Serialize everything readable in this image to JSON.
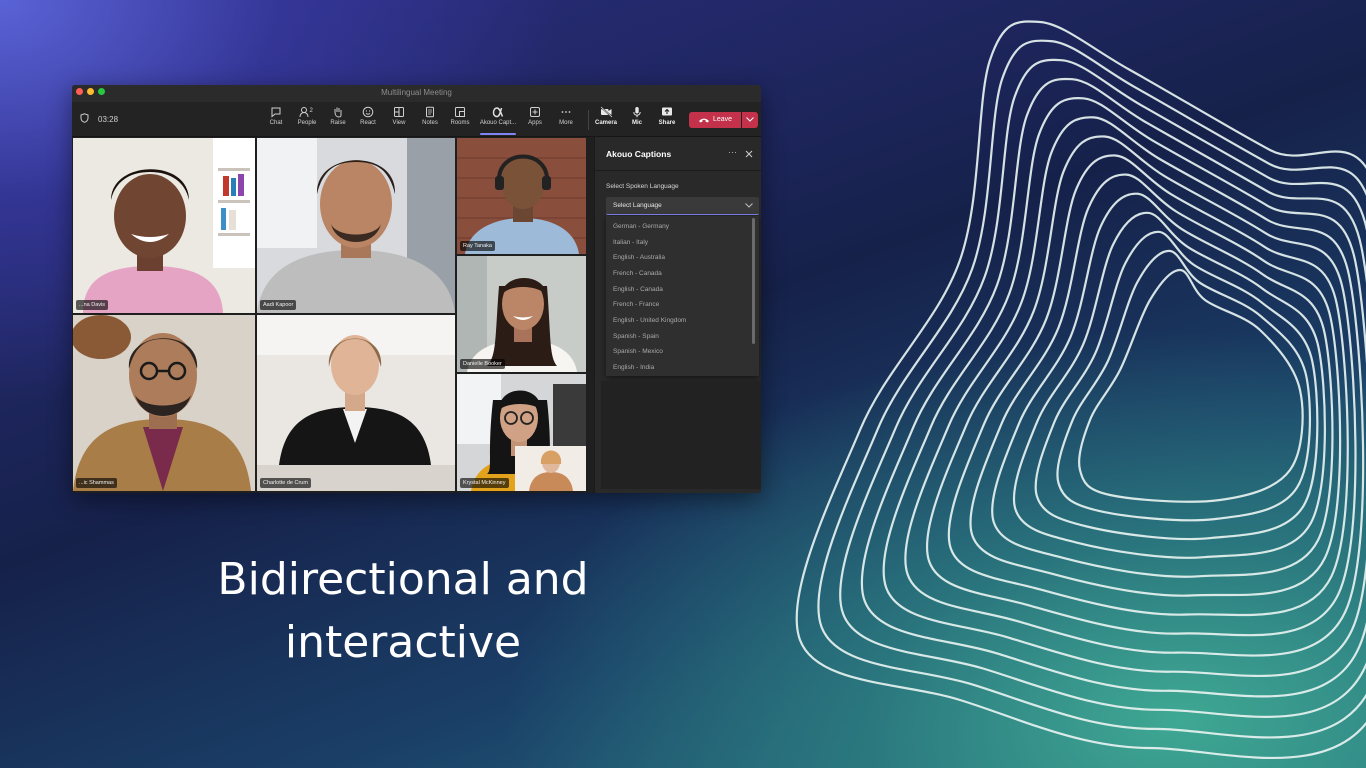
{
  "window": {
    "title": "Multilingual Meeting",
    "timer": "03:28"
  },
  "toolbar": {
    "chat": "Chat",
    "people": "People",
    "people_count": "2",
    "raise": "Raise",
    "react": "React",
    "view": "View",
    "notes": "Notes",
    "rooms": "Rooms",
    "akouo": "Akouo Capt...",
    "apps": "Apps",
    "more": "More",
    "camera": "Camera",
    "mic": "Mic",
    "share": "Share",
    "leave": "Leave",
    "accent": "#7f85f5",
    "leave_color": "#c4314b"
  },
  "participants": [
    "...na Davis",
    "Aadi Kapoor",
    "Ray Tanaka",
    "Danielle Booker",
    "...ic Shammas",
    "Charlotte de Crum",
    "Krystal McKinney"
  ],
  "captions_panel": {
    "title": "Akouo Captions",
    "more": "···",
    "label": "Select Spoken Language",
    "selected": "Select Language",
    "options": [
      "German - Germany",
      "Italian - Italy",
      "English - Australia",
      "French - Canada",
      "English - Canada",
      "French - France",
      "English - United Kingdom",
      "Spanish - Spain",
      "Spanish - Mexico",
      "English - India"
    ]
  },
  "headline": {
    "line1": "Bidirectional and",
    "line2": "interactive"
  }
}
